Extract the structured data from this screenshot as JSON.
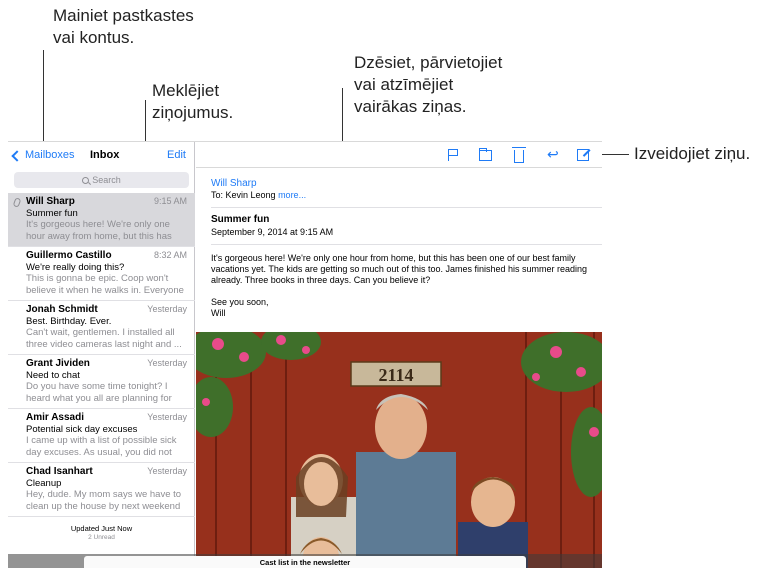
{
  "callouts": {
    "mailboxes": [
      "Mainiet pastkastes",
      "vai kontus."
    ],
    "search": [
      "Meklējiet",
      "ziņojumus."
    ],
    "actions": [
      "Dzēsiet, pārvietojiet",
      "vai atzīmējiet",
      "vairākas ziņas."
    ],
    "compose": "Izveidojiet ziņu."
  },
  "sidebar": {
    "back_label": "Mailboxes",
    "title": "Inbox",
    "edit_label": "Edit",
    "search_placeholder": "Search",
    "messages": [
      {
        "sender": "Will Sharp",
        "time": "9:15 AM",
        "subject": "Summer fun",
        "preview": "It's gorgeous here! We're only one hour away from home, but this has been ...",
        "selected": true,
        "attachment": true
      },
      {
        "sender": "Guillermo Castillo",
        "time": "8:32 AM",
        "subject": "We're really doing this?",
        "preview": "This is gonna be epic. Coop won't believe it when he walks in. Everyone ..."
      },
      {
        "sender": "Jonah Schmidt",
        "time": "Yesterday",
        "subject": "Best. Birthday. Ever.",
        "preview": "Can't wait, gentlemen. I installed all three video cameras last night and ..."
      },
      {
        "sender": "Grant Jividen",
        "time": "Yesterday",
        "subject": "Need to chat",
        "preview": "Do you have some time tonight? I heard what you all are planning for the party ..."
      },
      {
        "sender": "Amir Assadi",
        "time": "Yesterday",
        "subject": "Potential sick day excuses",
        "preview": "I came up with a list of possible sick day excuses. As usual, you did not get ..."
      },
      {
        "sender": "Chad Isanhart",
        "time": "Yesterday",
        "subject": "Cleanup",
        "preview": "Hey, dude. My mom says we have to clean up the house by next weekend ..."
      }
    ],
    "updated": "Updated Just Now",
    "unread": "2 Unread"
  },
  "message": {
    "from": "Will Sharp",
    "to_prefix": "To: Kevin Leong",
    "more": "more...",
    "subject": "Summer fun",
    "date": "September 9, 2014 at 9:15 AM",
    "body": "It's gorgeous here! We're only one hour from home, but this has been one of our best family vacations yet. The kids are getting so much out of this too. James finished his summer reading already. Three books in three days. Can you believe it?",
    "signoff": "See you soon,",
    "signature": "Will",
    "photo_sign": "2114"
  },
  "draft_sheet": {
    "title": "Cast list in the newsletter"
  },
  "colors": {
    "accent": "#1f7bf6",
    "muted": "#8e8e93",
    "selected_row": "#d8d8dc"
  }
}
